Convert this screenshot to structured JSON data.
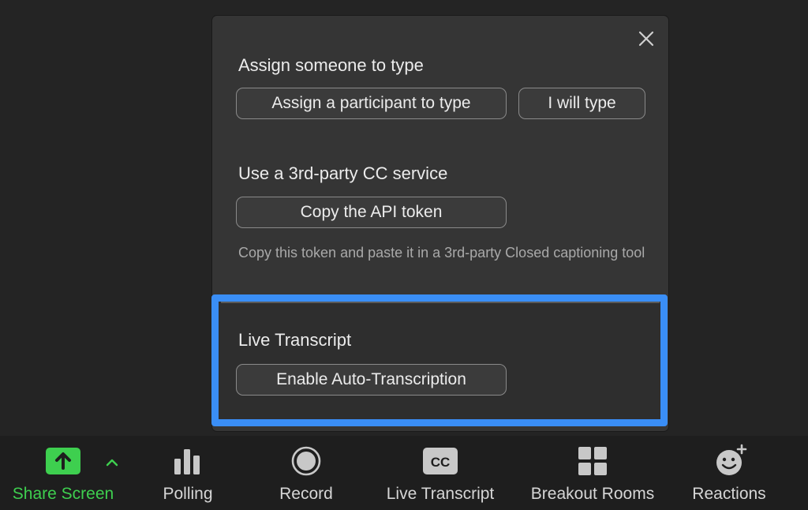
{
  "dialog": {
    "close_icon": "close-icon",
    "assign_section": {
      "title": "Assign someone to type",
      "assign_participant_button": "Assign a participant to type",
      "i_will_type_button": "I will type"
    },
    "cc_section": {
      "title": "Use a 3rd-party CC service",
      "copy_token_button": "Copy the API token",
      "help_text": "Copy this token and paste it in a 3rd-party Closed captioning tool"
    },
    "live_transcript_section": {
      "title": "Live Transcript",
      "enable_button": "Enable Auto-Transcription"
    }
  },
  "toolbar": {
    "items": [
      {
        "label": "Share Screen",
        "icon": "share-screen-icon",
        "color": "#3ecf4f"
      },
      {
        "label": "Polling",
        "icon": "polling-icon"
      },
      {
        "label": "Record",
        "icon": "record-icon"
      },
      {
        "label": "Live Transcript",
        "icon": "cc-icon"
      },
      {
        "label": "Breakout Rooms",
        "icon": "breakout-rooms-icon"
      },
      {
        "label": "Reactions",
        "icon": "reactions-icon"
      }
    ],
    "share_arrow_icon": "chevron-up-icon"
  },
  "colors": {
    "highlight": "#3a8ef6",
    "share_green": "#3ecf4f"
  }
}
